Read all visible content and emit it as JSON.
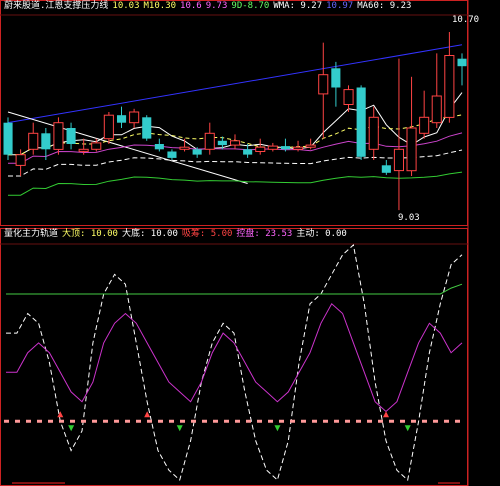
{
  "colors": {
    "bg": "#000000",
    "frame": "#cc2222",
    "up": "#ff4444",
    "down": "#33cccc",
    "ma_white": "#ffffff",
    "ma_purple": "#cc44cc",
    "ma_yellow": "#ffff66",
    "ma_green": "#33cc33",
    "trend_blue": "#3333ff",
    "osc_white": "#ffffff",
    "osc_purple": "#cc33cc",
    "osc_green_line": "#44cc44",
    "pink_dash": "#ff9999"
  },
  "price_panel": {
    "header": [
      {
        "text": "蔚来股道.江恩支撑压力线",
        "color": "#ffffff"
      },
      {
        "text": "10.03",
        "color": "#ffff66"
      },
      {
        "text": "M10.30",
        "color": "#ffff66"
      },
      {
        "text": "10.6",
        "color": "#ff66ff"
      },
      {
        "text": "9.73",
        "color": "#ff66ff"
      },
      {
        "text": "9D-8.70",
        "color": "#66ff66"
      },
      {
        "text": "WMA: 9.27",
        "color": "#ffffff"
      },
      {
        "text": "10.97",
        "color": "#6666ff"
      },
      {
        "text": "MA60: 9.23",
        "color": "#ffffff"
      }
    ],
    "high_label": "10.70",
    "low_label": "9.03"
  },
  "indicator_panel": {
    "header": [
      {
        "text": "量化主力轨道",
        "color": "#ffffff"
      },
      {
        "text": "大顶: 10.00",
        "color": "#ffff66"
      },
      {
        "text": "大底: 10.00",
        "color": "#ffffff"
      },
      {
        "text": "吸筹: 5.00",
        "color": "#ff4444"
      },
      {
        "text": "控盘: 23.53",
        "color": "#ff66ff"
      },
      {
        "text": "主动: 0.00",
        "color": "#ffffff"
      }
    ]
  },
  "chart_data": [
    {
      "type": "candlestick",
      "title": "蔚来股道.江恩支撑压力线",
      "ylim": [
        8.9,
        10.85
      ],
      "candles": [
        {
          "o": 9.85,
          "c": 9.55,
          "h": 9.9,
          "l": 9.5
        },
        {
          "o": 9.45,
          "c": 9.55,
          "h": 9.6,
          "l": 9.35
        },
        {
          "o": 9.6,
          "c": 9.75,
          "h": 9.85,
          "l": 9.55
        },
        {
          "o": 9.75,
          "c": 9.6,
          "h": 9.8,
          "l": 9.5
        },
        {
          "o": 9.6,
          "c": 9.85,
          "h": 9.9,
          "l": 9.55
        },
        {
          "o": 9.8,
          "c": 9.65,
          "h": 9.85,
          "l": 9.6
        },
        {
          "o": 9.58,
          "c": 9.6,
          "h": 9.7,
          "l": 9.55
        },
        {
          "o": 9.6,
          "c": 9.66,
          "h": 9.7,
          "l": 9.58
        },
        {
          "o": 9.7,
          "c": 9.92,
          "h": 9.95,
          "l": 9.65
        },
        {
          "o": 9.92,
          "c": 9.85,
          "h": 10.0,
          "l": 9.8
        },
        {
          "o": 9.85,
          "c": 9.95,
          "h": 9.98,
          "l": 9.8
        },
        {
          "o": 9.9,
          "c": 9.7,
          "h": 9.92,
          "l": 9.68
        },
        {
          "o": 9.65,
          "c": 9.6,
          "h": 9.7,
          "l": 9.58
        },
        {
          "o": 9.58,
          "c": 9.52,
          "h": 9.6,
          "l": 9.5
        },
        {
          "o": 9.6,
          "c": 9.62,
          "h": 9.7,
          "l": 9.58
        },
        {
          "o": 9.6,
          "c": 9.55,
          "h": 9.62,
          "l": 9.52
        },
        {
          "o": 9.6,
          "c": 9.75,
          "h": 9.85,
          "l": 9.55
        },
        {
          "o": 9.68,
          "c": 9.64,
          "h": 9.72,
          "l": 9.6
        },
        {
          "o": 9.64,
          "c": 9.68,
          "h": 9.74,
          "l": 9.6
        },
        {
          "o": 9.6,
          "c": 9.55,
          "h": 9.65,
          "l": 9.52
        },
        {
          "o": 9.58,
          "c": 9.62,
          "h": 9.7,
          "l": 9.55
        },
        {
          "o": 9.6,
          "c": 9.63,
          "h": 9.66,
          "l": 9.58
        },
        {
          "o": 9.63,
          "c": 9.6,
          "h": 9.7,
          "l": 9.58
        },
        {
          "o": 9.6,
          "c": 9.62,
          "h": 9.68,
          "l": 9.58
        },
        {
          "o": 9.62,
          "c": 9.64,
          "h": 9.7,
          "l": 9.6
        },
        {
          "o": 10.12,
          "c": 10.3,
          "h": 10.6,
          "l": 9.7
        },
        {
          "o": 10.36,
          "c": 10.18,
          "h": 10.42,
          "l": 10.0
        },
        {
          "o": 10.02,
          "c": 10.16,
          "h": 10.2,
          "l": 9.95
        },
        {
          "o": 10.18,
          "c": 9.53,
          "h": 10.2,
          "l": 9.5
        },
        {
          "o": 9.6,
          "c": 9.9,
          "h": 10.0,
          "l": 9.5
        },
        {
          "o": 9.45,
          "c": 9.38,
          "h": 9.5,
          "l": 9.36
        },
        {
          "o": 9.4,
          "c": 9.6,
          "h": 10.45,
          "l": 9.03
        },
        {
          "o": 9.4,
          "c": 9.8,
          "h": 10.28,
          "l": 9.35
        },
        {
          "o": 9.75,
          "c": 9.9,
          "h": 10.15,
          "l": 9.7
        },
        {
          "o": 9.85,
          "c": 10.1,
          "h": 10.5,
          "l": 9.8
        },
        {
          "o": 9.9,
          "c": 10.48,
          "h": 10.7,
          "l": 9.85
        },
        {
          "o": 10.45,
          "c": 10.38,
          "h": 10.5,
          "l": 10.2
        }
      ]
    },
    {
      "type": "line",
      "title": "量化主力轨道",
      "ylim": [
        -10,
        110
      ],
      "series": [
        {
          "name": "大顶",
          "values": [
            65,
            65,
            75,
            70,
            50,
            20,
            5,
            15,
            60,
            85,
            95,
            90,
            60,
            30,
            5,
            -5,
            -10,
            10,
            40,
            60,
            70,
            65,
            35,
            10,
            -5,
            -10,
            10,
            50,
            80,
            85,
            95,
            105,
            110,
            80,
            40,
            10,
            -5,
            -10,
            20,
            55,
            80,
            100,
            105
          ]
        },
        {
          "name": "控盘",
          "values": [
            45,
            45,
            55,
            60,
            55,
            45,
            35,
            30,
            40,
            60,
            70,
            75,
            70,
            60,
            50,
            40,
            35,
            30,
            40,
            55,
            65,
            60,
            50,
            40,
            35,
            30,
            35,
            45,
            55,
            70,
            80,
            75,
            60,
            45,
            30,
            25,
            30,
            45,
            60,
            70,
            65,
            55,
            60
          ]
        },
        {
          "name": "大底",
          "values": [
            85,
            85,
            85,
            85,
            85,
            85,
            85,
            85,
            85,
            85,
            85,
            85,
            85,
            85,
            85,
            85,
            85,
            85,
            85,
            85,
            85,
            85,
            85,
            85,
            85,
            85,
            85,
            85,
            85,
            85,
            85,
            85,
            85,
            85,
            85,
            85,
            85,
            85,
            85,
            85,
            85,
            88,
            90
          ]
        }
      ]
    }
  ]
}
